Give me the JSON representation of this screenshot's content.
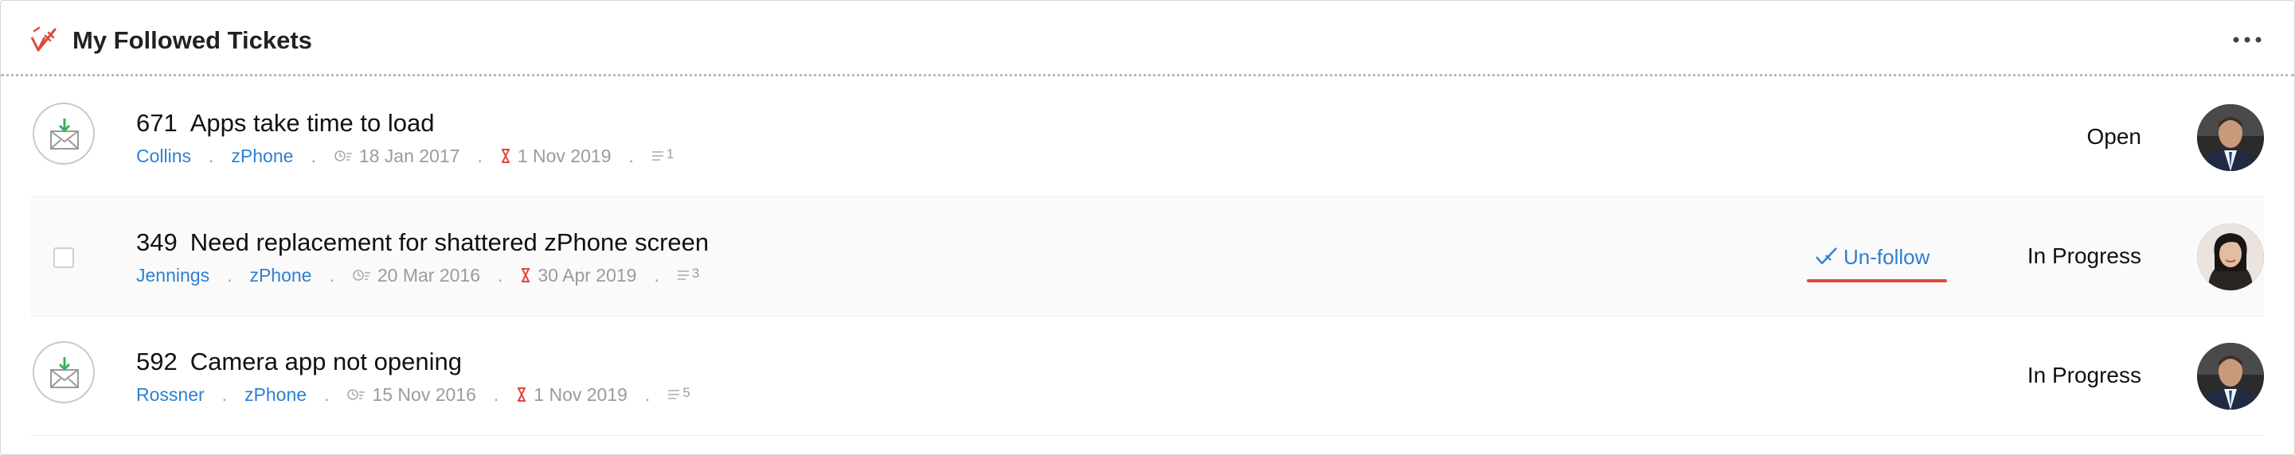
{
  "header": {
    "title": "My Followed Tickets",
    "logo_icon": "followed-tickets-logo-icon",
    "more_icon": "more-horizontal-icon"
  },
  "tickets": [
    {
      "number": "671",
      "subject": "Apps take time to load",
      "contact": "Collins",
      "product": "zPhone",
      "separator": ".",
      "created": "18 Jan 2017",
      "due": "1 Nov 2019",
      "threads": "1",
      "status": "Open",
      "selector": "mail-status-icon",
      "action": null
    },
    {
      "number": "349",
      "subject": "Need replacement for shattered zPhone screen",
      "contact": "Jennings",
      "product": "zPhone",
      "separator": ".",
      "created": "20 Mar 2016",
      "due": "30 Apr 2019",
      "threads": "3",
      "status": "In Progress",
      "selector": "checkbox",
      "action": "Un-follow"
    },
    {
      "number": "592",
      "subject": "Camera app not opening",
      "contact": "Rossner",
      "product": "zPhone",
      "separator": ".",
      "created": "15 Nov 2016",
      "due": "1 Nov 2019",
      "threads": "5",
      "status": "In Progress",
      "selector": "mail-status-icon",
      "action": null
    }
  ],
  "colors": {
    "link": "#2d7fd3",
    "accent_red": "#e0473c",
    "muted": "#9b9b9b",
    "hover_row": "#fafafa"
  }
}
